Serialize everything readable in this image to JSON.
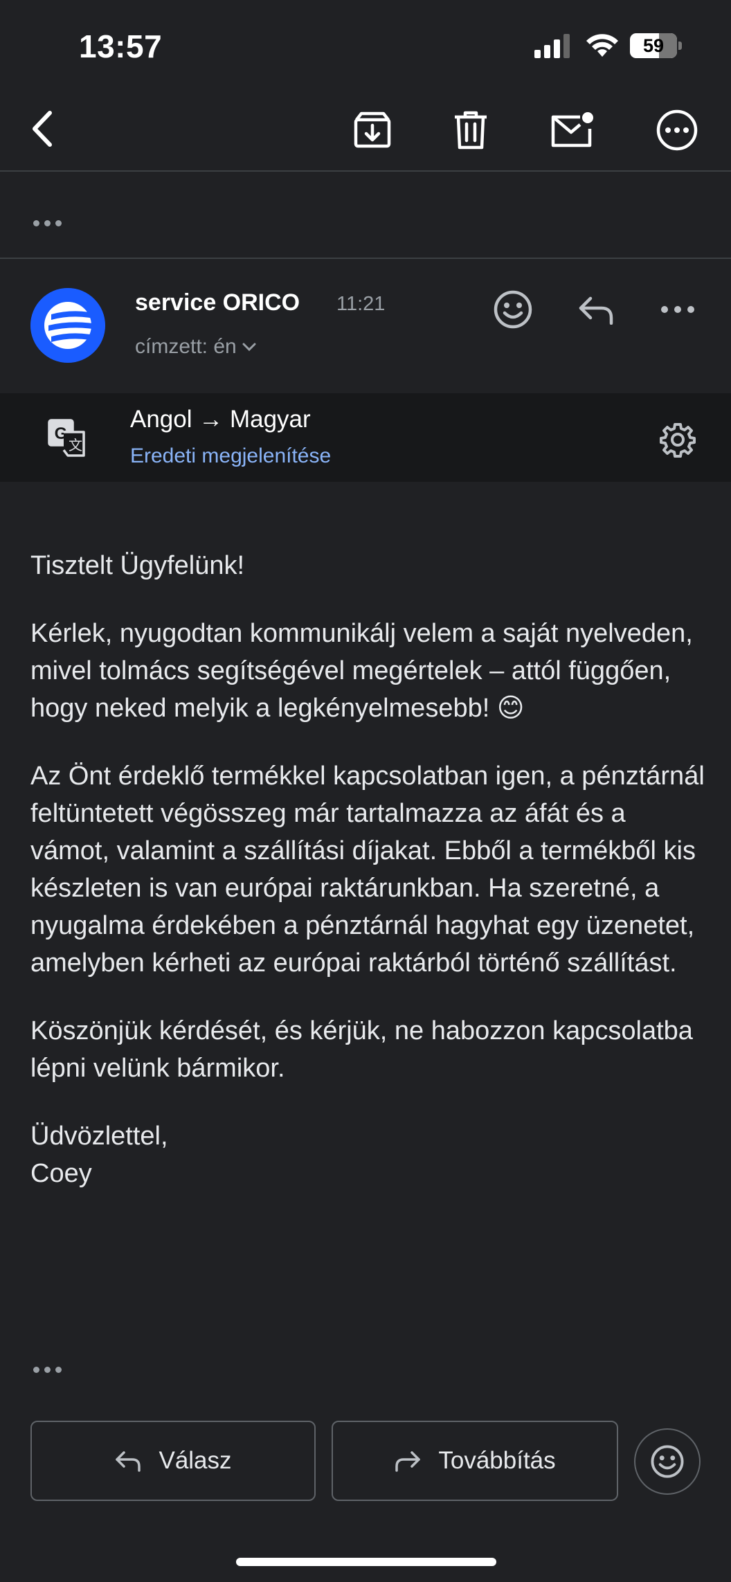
{
  "status_bar": {
    "time": "13:57",
    "battery": "59"
  },
  "message": {
    "sender": "service ORICO",
    "time": "11:21",
    "recipient": "címzett: én"
  },
  "translation": {
    "languages": "Angol → Magyar",
    "show_original": "Eredeti megjelenítése"
  },
  "body": {
    "greeting": "Tisztelt Ügyfelünk!",
    "paragraph1": "Kérlek, nyugodtan kommunikálj velem a saját nyelveden, mivel tolmács segítségével megértelek – attól függően, hogy neked melyik a legkényelmesebb! 😊",
    "paragraph2": "Az Önt érdeklő termékkel kapcsolatban igen, a pénztárnál feltüntetett végösszeg már tartalmazza az áfát és a vámot, valamint a szállítási díjakat. Ebből a termékből kis készleten is van európai raktárunkban. Ha szeretné, a nyugalma érdekében a pénztárnál hagyhat egy üzenetet, amelyben kérheti az európai raktárból történő szállítást.",
    "paragraph3": "Köszönjük kérdését, és kérjük, ne habozzon kapcsolatba lépni velünk bármikor.",
    "closing": "Üdvözlettel,",
    "signature": "Coey"
  },
  "actions": {
    "reply_label": "Válasz",
    "forward_label": "Továbbítás"
  },
  "icons": [
    "back-icon",
    "archive-icon",
    "trash-icon",
    "mark-unread-icon",
    "more-circle-icon",
    "emoji-icon",
    "reply-icon",
    "more-horizontal-icon",
    "translate-icon",
    "settings-icon",
    "forward-icon",
    "chevron-down-icon"
  ],
  "colors": {
    "background": "#202124",
    "link": "#8ab4f8",
    "avatar": "#1a5cff"
  }
}
